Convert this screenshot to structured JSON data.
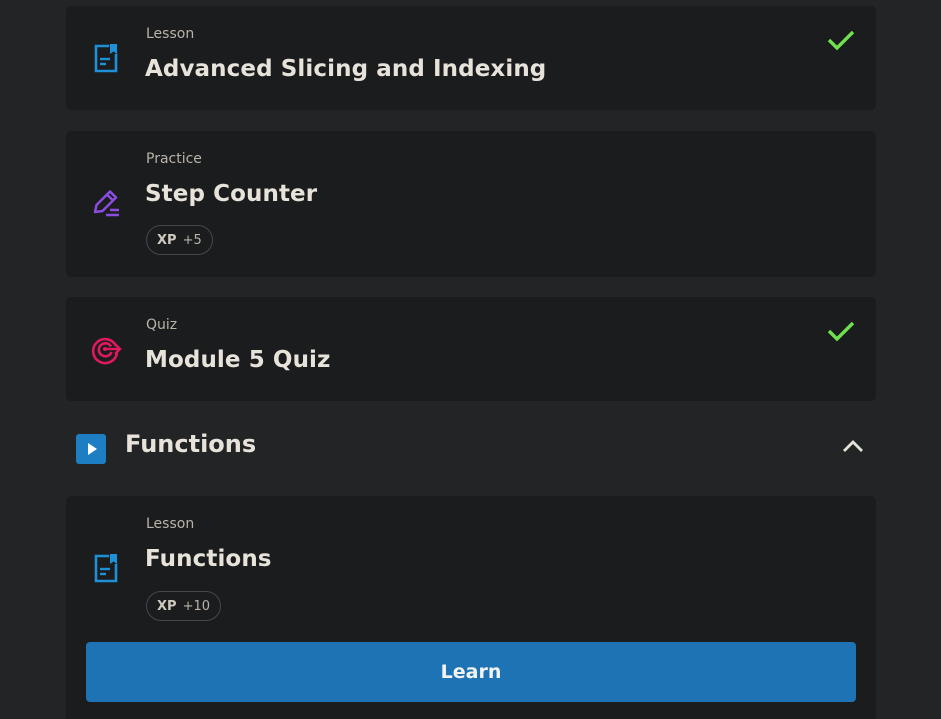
{
  "items": [
    {
      "type_label": "Lesson",
      "title": "Advanced Slicing and Indexing",
      "icon": "lesson-document-icon",
      "completed": true
    },
    {
      "type_label": "Practice",
      "title": "Step Counter",
      "icon": "pencil-icon",
      "completed": false,
      "xp_label": "XP",
      "xp_value": "+5"
    },
    {
      "type_label": "Quiz",
      "title": "Module 5 Quiz",
      "icon": "target-icon",
      "completed": true
    }
  ],
  "section": {
    "title": "Functions",
    "icon": "play-icon",
    "expanded": true
  },
  "section_items": [
    {
      "type_label": "Lesson",
      "title": "Functions",
      "icon": "lesson-document-icon",
      "xp_label": "XP",
      "xp_value": "+10",
      "button_label": "Learn"
    }
  ],
  "colors": {
    "background": "#232425",
    "card": "#1b1c1e",
    "lesson_icon": "#1e90d8",
    "practice_icon": "#8a4de0",
    "quiz_icon": "#e0195f",
    "check": "#6fe04e",
    "button": "#1e73b4"
  }
}
